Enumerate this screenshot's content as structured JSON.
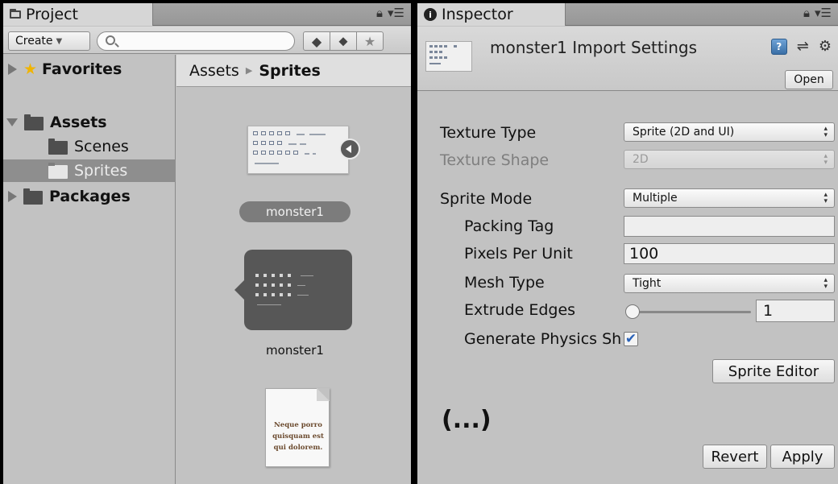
{
  "project": {
    "tab_label": "Project",
    "tab_icon": "folder-icon",
    "create_label": "Create",
    "search_placeholder": "",
    "tree": {
      "favorites": "Favorites",
      "assets": "Assets",
      "scenes": "Scenes",
      "sprites": "Sprites",
      "packages": "Packages"
    },
    "breadcrumb": {
      "root": "Assets",
      "current": "Sprites"
    },
    "items": [
      {
        "label": "monster1",
        "kind": "texture",
        "selected": true
      },
      {
        "label": "monster1",
        "kind": "sprite"
      },
      {
        "label": "",
        "kind": "text-document",
        "preview_text": "Neque porro quisquam est qui dolorem."
      }
    ]
  },
  "inspector": {
    "tab_label": "Inspector",
    "tab_icon": "info-icon",
    "title": "monster1 Import Settings",
    "open_label": "Open",
    "texture_type_label": "Texture Type",
    "texture_type_value": "Sprite (2D and UI)",
    "texture_shape_label": "Texture Shape",
    "texture_shape_value": "2D",
    "sprite_mode_label": "Sprite Mode",
    "sprite_mode_value": "Multiple",
    "packing_tag_label": "Packing Tag",
    "packing_tag_value": "",
    "pixels_per_unit_label": "Pixels Per Unit",
    "pixels_per_unit_value": "100",
    "mesh_type_label": "Mesh Type",
    "mesh_type_value": "Tight",
    "extrude_edges_label": "Extrude Edges",
    "extrude_edges_value": "1",
    "generate_physics_label": "Generate Physics Sh",
    "generate_physics_checked": true,
    "sprite_editor_label": "Sprite Editor",
    "ellipsis": "(...)",
    "revert_label": "Revert",
    "apply_label": "Apply"
  },
  "colors": {
    "panel_bg": "#c2c2c2",
    "selection": "#8e8e8e",
    "favorite_star": "#f0b400",
    "checkbox_tick": "#2a62b8"
  }
}
